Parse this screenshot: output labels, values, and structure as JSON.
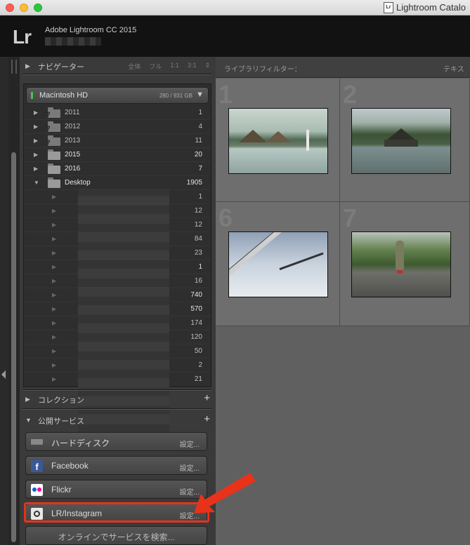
{
  "window": {
    "title": "Lightroom Catalo",
    "doc_icon": "Lr"
  },
  "header": {
    "logo": "Lr",
    "app_name": "Adobe Lightroom CC 2015"
  },
  "navigator": {
    "title": "ナビゲーター",
    "options": [
      "全体",
      "フル",
      "1:1",
      "3:1"
    ]
  },
  "volume": {
    "name": "Macintosh HD",
    "size": "280 / 931 GB"
  },
  "folders": [
    {
      "name": "2011",
      "count": "1"
    },
    {
      "name": "2012",
      "count": "4"
    },
    {
      "name": "2013",
      "count": "11"
    },
    {
      "name": "2015",
      "count": "20"
    },
    {
      "name": "2016",
      "count": "7"
    },
    {
      "name": "Desktop",
      "count": "1905"
    }
  ],
  "subfolders": [
    "1",
    "12",
    "12",
    "84",
    "23",
    "1",
    "16",
    "740",
    "570",
    "174",
    "120",
    "50",
    "2",
    "21"
  ],
  "collections": {
    "title": "コレクション"
  },
  "publish": {
    "title": "公開サービス",
    "services": [
      {
        "label": "ハードディスク",
        "settings": "設定..."
      },
      {
        "label": "Facebook",
        "settings": "設定..."
      },
      {
        "label": "Flickr",
        "settings": "設定..."
      },
      {
        "label": "LR/Instagram",
        "settings": "設定..."
      }
    ],
    "search_label": "オンラインでサービスを検索..."
  },
  "filterbar": {
    "label": "ライブラリフィルター：",
    "right": "テキス"
  },
  "grid": {
    "cell_numbers": [
      "1",
      "2",
      "6",
      "7"
    ]
  },
  "colors": {
    "highlight": "#e8321a",
    "panel": "#3a3a3a",
    "grid": "#606060"
  }
}
